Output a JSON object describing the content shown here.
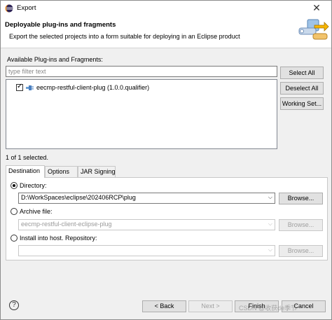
{
  "window": {
    "title": "Export",
    "close_glyph": "✕"
  },
  "header": {
    "title": "Deployable plug-ins and fragments",
    "description": "Export the selected projects into a form suitable for deploying in an Eclipse product",
    "icon": "export-plugin-wizard-icon"
  },
  "plugins": {
    "label": "Available Plug-ins and Fragments:",
    "filter_placeholder": "type filter text",
    "filter_value": "",
    "items": [
      {
        "label": "eecmp-restful-client-plug (1.0.0.qualifier)",
        "checked": true
      }
    ],
    "selected_text": "1 of 1 selected.",
    "buttons": {
      "select_all": "Select All",
      "deselect_all": "Deselect All",
      "working_set": "Working Set..."
    }
  },
  "tabs": [
    {
      "label": "Destination",
      "active": true
    },
    {
      "label": "Options",
      "active": false
    },
    {
      "label": "JAR Signing",
      "active": false
    }
  ],
  "destination": {
    "directory": {
      "label": "Directory:",
      "value": "D:\\WorkSpaces\\eclipse\\202406RCP\\plug",
      "selected": true,
      "browse": "Browse..."
    },
    "archive": {
      "label": "Archive file:",
      "value": "eecmp-restful-client-eclipse-plug",
      "selected": false,
      "browse": "Browse..."
    },
    "repository": {
      "label": "Install into host. Repository:",
      "value": "",
      "selected": false,
      "browse": "Browse..."
    }
  },
  "footer": {
    "help": "?",
    "back": "< Back",
    "next": "Next >",
    "finish": "Finish",
    "cancel": "Cancel"
  },
  "watermark": "CSDN @收获de季节"
}
